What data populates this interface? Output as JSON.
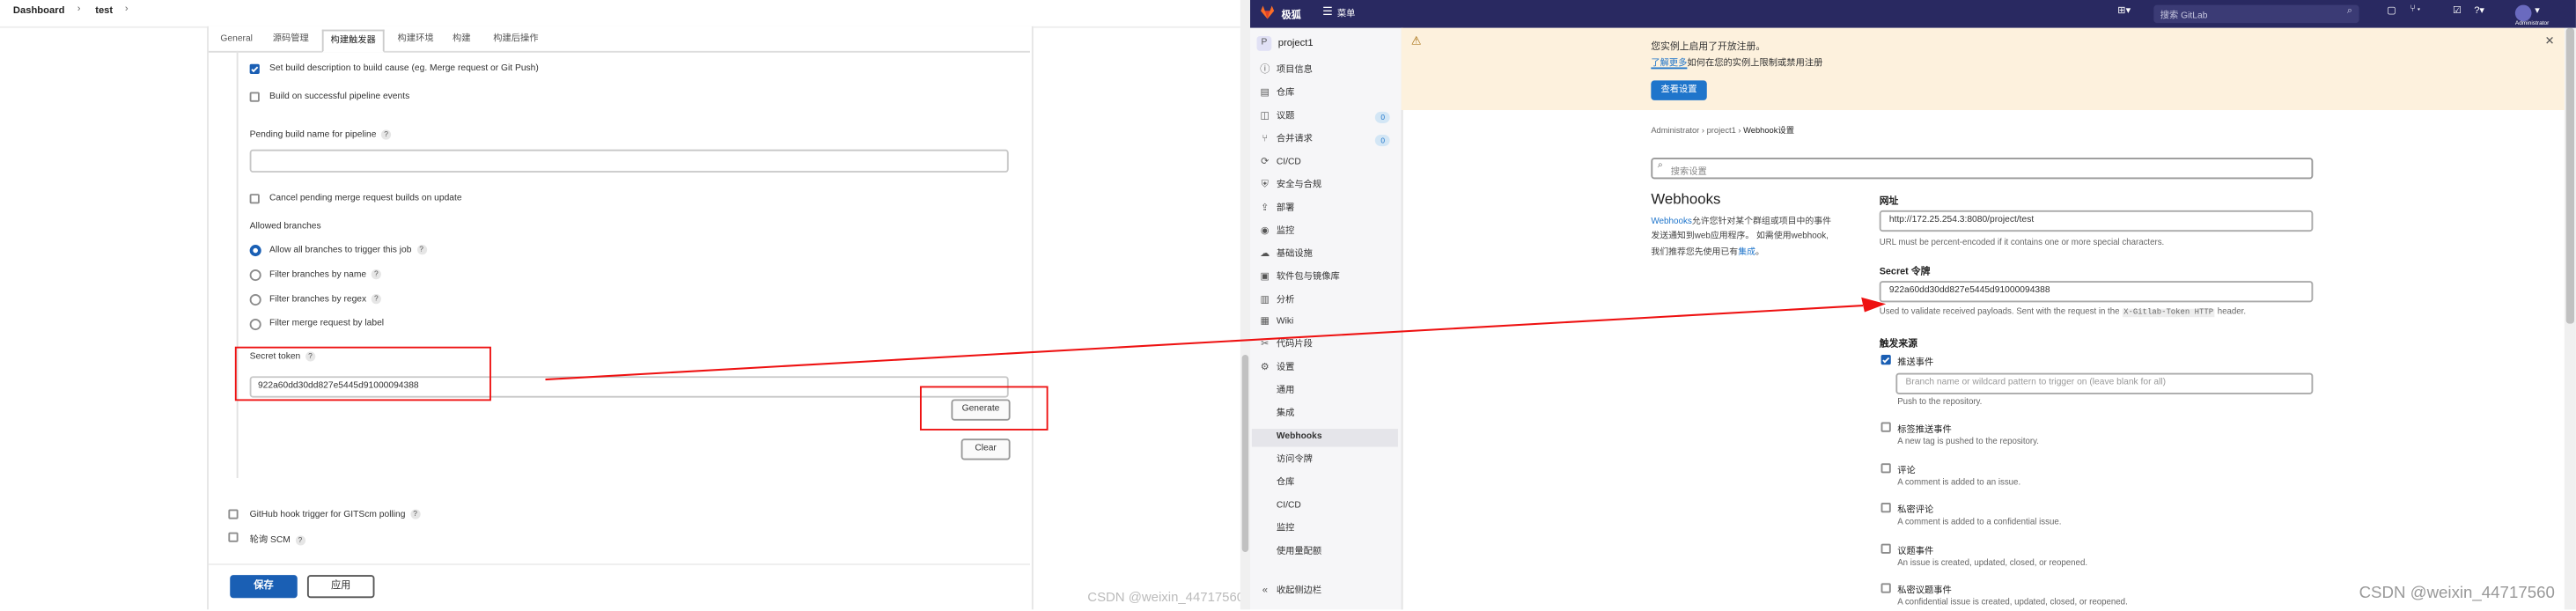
{
  "jenkins": {
    "breadcrumb": [
      "Dashboard",
      "test"
    ],
    "tabs": [
      "General",
      "源码管理",
      "构建触发器",
      "构建环境",
      "构建",
      "构建后操作"
    ],
    "options": {
      "set_build_desc": "Set build description to build cause (eg. Merge request or Git Push)",
      "build_on_pipeline": "Build on successful pipeline events",
      "pending_name_label": "Pending build name for pipeline",
      "cancel_pending": "Cancel pending merge request builds on update",
      "allowed_branches": "Allowed branches",
      "allow_all": "Allow all branches to trigger this job",
      "filter_by_name": "Filter branches by name",
      "filter_by_regex": "Filter branches by regex",
      "filter_merge_label": "Filter merge request by label",
      "secret_token_label": "Secret token",
      "secret_token_value": "922a60dd30dd827e5445d91000094388",
      "generate": "Generate",
      "clear": "Clear",
      "github_hook": "GitHub hook trigger for GITScm polling",
      "poll_scm": "轮询 SCM"
    },
    "save": "保存",
    "apply": "应用"
  },
  "watermark": "CSDN @weixin_44717560",
  "gitlab": {
    "topbar": {
      "logo_text": "极狐",
      "menu": "菜单",
      "search_placeholder": "搜索 GitLab",
      "avatar_text": "Administrator"
    },
    "sidebar": {
      "project_initial": "P",
      "project_name": "project1",
      "items": [
        {
          "icon": "ⓘ",
          "label": "项目信息",
          "badge": ""
        },
        {
          "icon": "▤",
          "label": "仓库",
          "badge": ""
        },
        {
          "icon": "◫",
          "label": "议题",
          "badge": "0"
        },
        {
          "icon": "⑂",
          "label": "合并请求",
          "badge": "0"
        },
        {
          "icon": "⟳",
          "label": "CI/CD",
          "badge": ""
        },
        {
          "icon": "⛨",
          "label": "安全与合规",
          "badge": ""
        },
        {
          "icon": "⇪",
          "label": "部署",
          "badge": ""
        },
        {
          "icon": "◉",
          "label": "监控",
          "badge": ""
        },
        {
          "icon": "☁",
          "label": "基础设施",
          "badge": ""
        },
        {
          "icon": "▣",
          "label": "软件包与镜像库",
          "badge": ""
        },
        {
          "icon": "▥",
          "label": "分析",
          "badge": ""
        },
        {
          "icon": "▦",
          "label": "Wiki",
          "badge": ""
        },
        {
          "icon": "✂",
          "label": "代码片段",
          "badge": ""
        },
        {
          "icon": "⚙",
          "label": "设置",
          "badge": ""
        }
      ],
      "subitems": [
        "通用",
        "集成",
        "Webhooks",
        "访问令牌",
        "仓库",
        "CI/CD",
        "监控",
        "使用量配额"
      ],
      "active_subitem": "Webhooks",
      "collapse": "收起侧边栏"
    },
    "alert": {
      "title": "您实例上启用了开放注册。",
      "link": "了解更多",
      "text": "如何在您的实例上限制或禁用注册",
      "button": "查看设置"
    },
    "breadcrumb": [
      "Administrator",
      "project1",
      "Webhook设置"
    ],
    "settings_search_placeholder": "搜索设置",
    "webhooks": {
      "title": "Webhooks",
      "desc_link": "Webhooks",
      "desc_1": "允许您针对某个群组或项目中的事件",
      "desc_2": "发送通知到web应用程序。 如需使用webhook,",
      "desc_3": "我们推荐您先使用已有",
      "desc_link2": "集成",
      "desc_end": "。"
    },
    "form": {
      "url_label": "网址",
      "url_value": "http://172.25.254.3:8080/project/test",
      "url_help": "URL must be percent-encoded if it contains one or more special characters.",
      "secret_label": "Secret 令牌",
      "secret_value": "922a60dd30dd827e5445d91000094388",
      "secret_help_1": "Used to validate received payloads. Sent with the request in the",
      "secret_help_code": "X-Gitlab-Token HTTP",
      "secret_help_2": "header.",
      "trigger_label": "触发来源",
      "push_label": "推送事件",
      "push_placeholder": "Branch name or wildcard pattern to trigger on (leave blank for all)",
      "push_help": "Push to the repository.",
      "events": [
        {
          "label": "标签推送事件",
          "desc": "A new tag is pushed to the repository."
        },
        {
          "label": "评论",
          "desc": "A comment is added to an issue."
        },
        {
          "label": "私密评论",
          "desc": "A comment is added to a confidential issue."
        },
        {
          "label": "议题事件",
          "desc": "An issue is created, updated, closed, or reopened."
        },
        {
          "label": "私密议题事件",
          "desc": "A confidential issue is created, updated, closed, or reopened."
        }
      ]
    }
  },
  "colors": {
    "gitlab_topbar": "#292961",
    "jenkins_primary": "#1a5fb4",
    "annotation_red": "#e11111",
    "alert_bg": "#fdf1dd",
    "gitlab_primary": "#1f75cb"
  }
}
